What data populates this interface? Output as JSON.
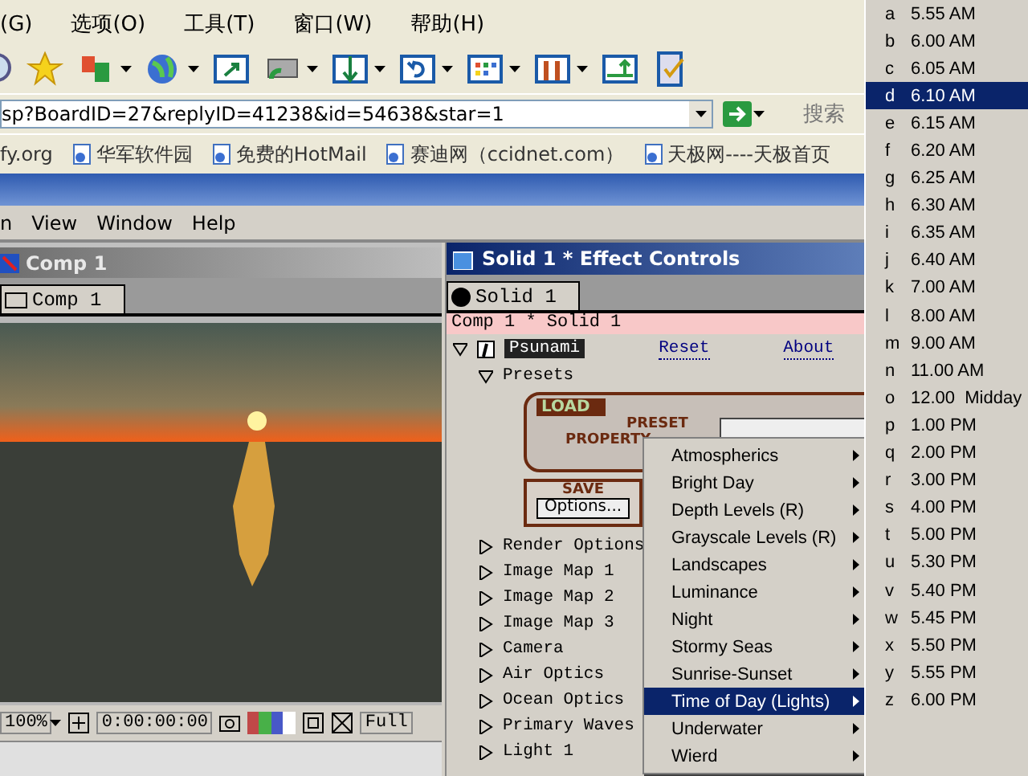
{
  "browser": {
    "menu": [
      "(G)",
      "选项(O)",
      "工具(T)",
      "窗口(W)",
      "帮助(H)"
    ],
    "address": "sp?BoardID=27&replyID=41238&id=54638&star=1",
    "search_label": "搜索",
    "links": [
      "fy.org",
      "华军软件园",
      "免费的HotMail",
      "赛迪网（ccidnet.com）",
      "天极网----天极首页"
    ]
  },
  "app_menu": [
    "n",
    "View",
    "Window",
    "Help"
  ],
  "comp_panel": {
    "title": "Comp 1",
    "tab": "Comp 1",
    "zoom": "100%",
    "timecode": "0:00:00:00",
    "resolution": "Full"
  },
  "effect_panel": {
    "title": "Solid 1 * Effect Controls",
    "tab": "Solid 1",
    "breadcrumb": "Comp 1 * Solid 1",
    "effect": "Psunami",
    "reset": "Reset",
    "about": "About",
    "presets": {
      "label": "Presets",
      "expanded": true
    },
    "load_label": "LOAD",
    "preset_label": "PRESET",
    "property_label": "PROPERTY",
    "save_label": "SAVE",
    "options_button": "Options...",
    "groups": [
      {
        "label": "Render Options",
        "expanded": false
      },
      {
        "label": "Image Map 1",
        "expanded": false
      },
      {
        "label": "Image Map 2",
        "expanded": false
      },
      {
        "label": "Image Map 3",
        "expanded": false
      },
      {
        "label": "Camera",
        "expanded": false
      },
      {
        "label": "Air Optics",
        "expanded": false
      },
      {
        "label": "Ocean Optics",
        "expanded": false
      },
      {
        "label": "Primary Waves",
        "expanded": false
      },
      {
        "label": "Light 1",
        "expanded": false
      }
    ]
  },
  "preset_menu": [
    {
      "label": "Atmospherics",
      "selected": false
    },
    {
      "label": "Bright Day",
      "selected": false
    },
    {
      "label": "Depth Levels (R)",
      "selected": false
    },
    {
      "label": "Grayscale Levels (R)",
      "selected": false
    },
    {
      "label": "Landscapes",
      "selected": false
    },
    {
      "label": "Luminance",
      "selected": false
    },
    {
      "label": "Night",
      "selected": false
    },
    {
      "label": "Stormy Seas",
      "selected": false
    },
    {
      "label": "Sunrise-Sunset",
      "selected": false
    },
    {
      "label": "Time of Day (Lights)",
      "selected": true
    },
    {
      "label": "Underwater",
      "selected": false
    },
    {
      "label": "Wierd",
      "selected": false
    }
  ],
  "time_menu": [
    {
      "key": "a",
      "time": "5.55 AM",
      "selected": false
    },
    {
      "key": "b",
      "time": "6.00 AM",
      "selected": false
    },
    {
      "key": "c",
      "time": "6.05 AM",
      "selected": false
    },
    {
      "key": "d",
      "time": "6.10 AM",
      "selected": true
    },
    {
      "key": "e",
      "time": "6.15 AM",
      "selected": false
    },
    {
      "key": "f",
      "time": "6.20 AM",
      "selected": false
    },
    {
      "key": "g",
      "time": "6.25 AM",
      "selected": false
    },
    {
      "key": "h",
      "time": "6.30 AM",
      "selected": false
    },
    {
      "key": "i",
      "time": "6.35 AM",
      "selected": false
    },
    {
      "key": "j",
      "time": "6.40 AM",
      "selected": false
    },
    {
      "key": "k",
      "time": "7.00 AM",
      "selected": false
    },
    {
      "key": "l",
      "time": "8.00 AM",
      "selected": false
    },
    {
      "key": "m",
      "time": "9.00 AM",
      "selected": false
    },
    {
      "key": "n",
      "time": "11.00 AM",
      "selected": false
    },
    {
      "key": "o",
      "time": "12.00  Midday",
      "selected": false
    },
    {
      "key": "p",
      "time": "1.00 PM",
      "selected": false
    },
    {
      "key": "q",
      "time": "2.00 PM",
      "selected": false
    },
    {
      "key": "r",
      "time": "3.00 PM",
      "selected": false
    },
    {
      "key": "s",
      "time": "4.00 PM",
      "selected": false
    },
    {
      "key": "t",
      "time": "5.00 PM",
      "selected": false
    },
    {
      "key": "u",
      "time": "5.30 PM",
      "selected": false
    },
    {
      "key": "v",
      "time": "5.40 PM",
      "selected": false
    },
    {
      "key": "w",
      "time": "5.45 PM",
      "selected": false
    },
    {
      "key": "x",
      "time": "5.50 PM",
      "selected": false
    },
    {
      "key": "y",
      "time": "5.55 PM",
      "selected": false
    },
    {
      "key": "z",
      "time": "6.00 PM",
      "selected": false
    }
  ]
}
